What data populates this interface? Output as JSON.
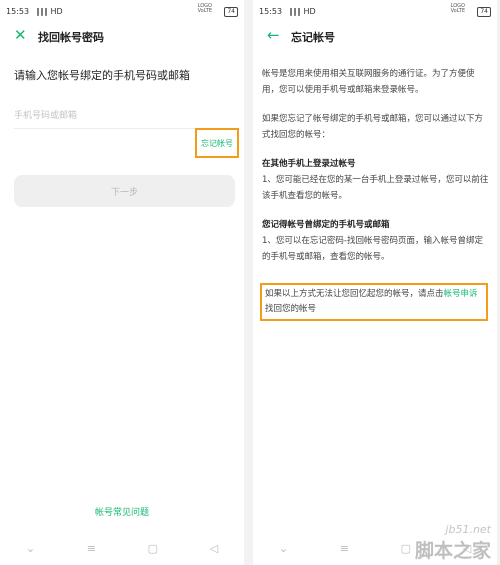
{
  "left": {
    "status": {
      "time": "15:53",
      "signal": "∥∥∥ HD",
      "lte": "LOGO\nVoLTE",
      "battery": "74"
    },
    "header": {
      "title": "找回帐号密码"
    },
    "prompt": "请输入您帐号绑定的手机号码或邮箱",
    "input_placeholder": "手机号码或邮箱",
    "forgot_label": "忘记帐号",
    "next_label": "下一步",
    "faq_label": "帐号常见问题"
  },
  "right": {
    "status": {
      "time": "15:53",
      "signal": "∥∥∥ HD",
      "lte": "LOGO\nVoLTE",
      "battery": "74"
    },
    "header": {
      "title": "忘记帐号"
    },
    "para1": "帐号是您用来使用相关互联网服务的通行证。为了方便使用，您可以使用手机号或邮箱来登录帐号。",
    "para2": "如果您忘记了帐号绑定的手机号或邮箱，您可以通过以下方式找回您的帐号：",
    "section1_title": "在其他手机上登录过帐号",
    "section1_body": "1、您可能已经在您的某一台手机上登录过帐号，您可以前往该手机查看您的帐号。",
    "section2_title": "您记得帐号曾绑定的手机号或邮箱",
    "section2_body": "1、您可以在忘记密码-找回帐号密码页面，输入帐号曾绑定的手机号或邮箱，查看您的帐号。",
    "appeal_prefix": "如果以上方式无法让您回忆起您的帐号，请点击",
    "appeal_link": "帐号申诉",
    "appeal_suffix": "找回您的帐号"
  },
  "watermark": {
    "url": "jb51.net",
    "cn": "脚本之家"
  },
  "nav_icons": [
    "⌄",
    "≡",
    "▢",
    "◁"
  ],
  "colors": {
    "accent": "#14b873",
    "highlight": "#f39b1a"
  }
}
